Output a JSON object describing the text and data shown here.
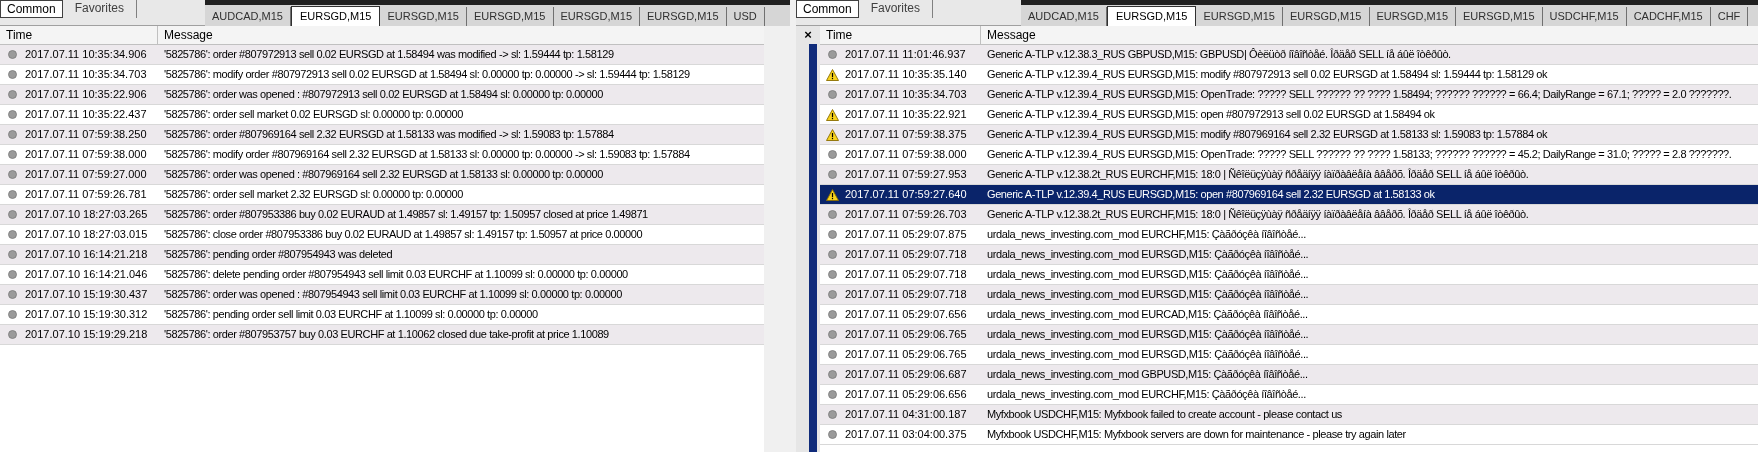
{
  "panels": [
    {
      "terminal_tabs": [
        {
          "label": "Common",
          "selected": true
        },
        {
          "label": "Favorites",
          "selected": false
        }
      ],
      "chart_tabs": [
        {
          "label": "AUDCAD,M15",
          "selected": false
        },
        {
          "label": "EURSGD,M15",
          "selected": true
        },
        {
          "label": "EURSGD,M15",
          "selected": false
        },
        {
          "label": "EURSGD,M15",
          "selected": false
        },
        {
          "label": "EURSGD,M15",
          "selected": false
        },
        {
          "label": "EURSGD,M15",
          "selected": false
        },
        {
          "label": "USD",
          "selected": false
        }
      ],
      "columns": [
        "Time",
        "Message"
      ],
      "rows": [
        {
          "kind": "info",
          "selected": false,
          "time": "2017.07.11 10:35:34.906",
          "message": "'5825786': order #807972913 sell 0.02 EURSGD at 1.58494 was modified -> sl: 1.59444 tp: 1.58129"
        },
        {
          "kind": "info",
          "selected": false,
          "time": "2017.07.11 10:35:34.703",
          "message": "'5825786': modify order #807972913 sell 0.02 EURSGD at 1.58494 sl: 0.00000 tp: 0.00000 -> sl: 1.59444 tp: 1.58129"
        },
        {
          "kind": "info",
          "selected": false,
          "time": "2017.07.11 10:35:22.906",
          "message": "'5825786': order was opened : #807972913 sell 0.02 EURSGD at 1.58494 sl: 0.00000 tp: 0.00000"
        },
        {
          "kind": "info",
          "selected": false,
          "time": "2017.07.11 10:35:22.437",
          "message": "'5825786': order sell market 0.02 EURSGD sl: 0.00000 tp: 0.00000"
        },
        {
          "kind": "info",
          "selected": false,
          "time": "2017.07.11 07:59:38.250",
          "message": "'5825786': order #807969164 sell 2.32 EURSGD at 1.58133 was modified -> sl: 1.59083 tp: 1.57884"
        },
        {
          "kind": "info",
          "selected": false,
          "time": "2017.07.11 07:59:38.000",
          "message": "'5825786': modify order #807969164 sell 2.32 EURSGD at 1.58133 sl: 0.00000 tp: 0.00000 -> sl: 1.59083 tp: 1.57884"
        },
        {
          "kind": "info",
          "selected": false,
          "time": "2017.07.11 07:59:27.000",
          "message": "'5825786': order was opened : #807969164 sell 2.32 EURSGD at 1.58133 sl: 0.00000 tp: 0.00000"
        },
        {
          "kind": "info",
          "selected": false,
          "time": "2017.07.11 07:59:26.781",
          "message": "'5825786': order sell market 2.32 EURSGD sl: 0.00000 tp: 0.00000"
        },
        {
          "kind": "info",
          "selected": false,
          "time": "2017.07.10 18:27:03.265",
          "message": "'5825786': order #807953386 buy 0.02 EURAUD at 1.49857 sl: 1.49157 tp: 1.50957 closed at price 1.49871"
        },
        {
          "kind": "info",
          "selected": false,
          "time": "2017.07.10 18:27:03.015",
          "message": "'5825786': close order #807953386 buy 0.02 EURAUD at 1.49857 sl: 1.49157 tp: 1.50957 at price 0.00000"
        },
        {
          "kind": "info",
          "selected": false,
          "time": "2017.07.10 16:14:21.218",
          "message": "'5825786': pending order #807954943 was deleted"
        },
        {
          "kind": "info",
          "selected": false,
          "time": "2017.07.10 16:14:21.046",
          "message": "'5825786': delete pending order #807954943 sell limit 0.03 EURCHF at 1.10099 sl: 0.00000 tp: 0.00000"
        },
        {
          "kind": "info",
          "selected": false,
          "time": "2017.07.10 15:19:30.437",
          "message": "'5825786': order was opened : #807954943 sell limit 0.03 EURCHF at 1.10099 sl: 0.00000 tp: 0.00000"
        },
        {
          "kind": "info",
          "selected": false,
          "time": "2017.07.10 15:19:30.312",
          "message": "'5825786': pending order sell limit 0.03 EURCHF at 1.10099 sl: 0.00000 tp: 0.00000"
        },
        {
          "kind": "info",
          "selected": false,
          "time": "2017.07.10 15:19:29.218",
          "message": "'5825786': order #807953757 buy 0.03 EURCHF at 1.10062 closed due take-profit at price 1.10089"
        }
      ]
    },
    {
      "close_glyph": "×",
      "terminal_tabs": [
        {
          "label": "Common",
          "selected": true
        },
        {
          "label": "Favorites",
          "selected": false
        }
      ],
      "chart_tabs": [
        {
          "label": "AUDCAD,M15",
          "selected": false
        },
        {
          "label": "EURSGD,M15",
          "selected": true
        },
        {
          "label": "EURSGD,M15",
          "selected": false
        },
        {
          "label": "EURSGD,M15",
          "selected": false
        },
        {
          "label": "EURSGD,M15",
          "selected": false
        },
        {
          "label": "EURSGD,M15",
          "selected": false
        },
        {
          "label": "USDCHF,M15",
          "selected": false
        },
        {
          "label": "CADCHF,M15",
          "selected": false
        },
        {
          "label": "CHF",
          "selected": false
        }
      ],
      "columns": [
        "Time",
        "Message"
      ],
      "rows": [
        {
          "kind": "info",
          "selected": false,
          "time": "2017.07.11 11:01:46.937",
          "message": "Generic A-TLP v.12.38.3_RUS GBPUSD,M15: GBPUSD| Ôèëüòð íîâîñòåé. Îðäåð SELL íå áûë îòêðûò."
        },
        {
          "kind": "warning",
          "selected": false,
          "time": "2017.07.11 10:35:35.140",
          "message": "Generic A-TLP v.12.39.4_RUS EURSGD,M15: modify #807972913 sell 0.02 EURSGD at 1.58494 sl: 1.59444 tp: 1.58129 ok"
        },
        {
          "kind": "info",
          "selected": false,
          "time": "2017.07.11 10:35:34.703",
          "message": "Generic A-TLP v.12.39.4_RUS EURSGD,M15: OpenTrade: ????? SELL ?????? ?? ???? 1.58494; ?????? ?????? = 66.4; DailyRange = 67.1; ????? = 2.0 ???????."
        },
        {
          "kind": "warning",
          "selected": false,
          "time": "2017.07.11 10:35:22.921",
          "message": "Generic A-TLP v.12.39.4_RUS EURSGD,M15: open #807972913 sell 0.02 EURSGD at 1.58494 ok"
        },
        {
          "kind": "warning",
          "selected": false,
          "time": "2017.07.11 07:59:38.375",
          "message": "Generic A-TLP v.12.39.4_RUS EURSGD,M15: modify #807969164 sell 2.32 EURSGD at 1.58133 sl: 1.59083 tp: 1.57884 ok"
        },
        {
          "kind": "info",
          "selected": false,
          "time": "2017.07.11 07:59:38.000",
          "message": "Generic A-TLP v.12.39.4_RUS EURSGD,M15: OpenTrade: ????? SELL ?????? ?? ???? 1.58133; ?????? ?????? = 45.2; DailyRange = 31.0; ????? = 2.8 ???????."
        },
        {
          "kind": "info",
          "selected": false,
          "time": "2017.07.11 07:59:27.953",
          "message": "Generic A-TLP v.12.38.2t_RUS EURCHF,M15: 18:0 | Ñêîëüçÿùàÿ ñðåäíÿÿ íàïðàâëåíà ââåðõ. Îðäåð SELL íå áûë îòêðûò."
        },
        {
          "kind": "warning",
          "selected": true,
          "time": "2017.07.11 07:59:27.640",
          "message": "Generic A-TLP v.12.39.4_RUS EURSGD,M15: open #807969164 sell 2.32 EURSGD at 1.58133 ok"
        },
        {
          "kind": "info",
          "selected": false,
          "time": "2017.07.11 07:59:26.703",
          "message": "Generic A-TLP v.12.38.2t_RUS EURCHF,M15: 18:0 | Ñêîëüçÿùàÿ ñðåäíÿÿ íàïðàâëåíà ââåðõ. Îðäåð SELL íå áûë îòêðûò."
        },
        {
          "kind": "info",
          "selected": false,
          "time": "2017.07.11 05:29:07.875",
          "message": "urdala_news_investing.com_mod EURCHF,M15: Çàãðóçêà íîâîñòåé..."
        },
        {
          "kind": "info",
          "selected": false,
          "time": "2017.07.11 05:29:07.718",
          "message": "urdala_news_investing.com_mod EURSGD,M15: Çàãðóçêà íîâîñòåé..."
        },
        {
          "kind": "info",
          "selected": false,
          "time": "2017.07.11 05:29:07.718",
          "message": "urdala_news_investing.com_mod EURSGD,M15: Çàãðóçêà íîâîñòåé..."
        },
        {
          "kind": "info",
          "selected": false,
          "time": "2017.07.11 05:29:07.718",
          "message": "urdala_news_investing.com_mod EURSGD,M15: Çàãðóçêà íîâîñòåé..."
        },
        {
          "kind": "info",
          "selected": false,
          "time": "2017.07.11 05:29:07.656",
          "message": "urdala_news_investing.com_mod EURCAD,M15: Çàãðóçêà íîâîñòåé..."
        },
        {
          "kind": "info",
          "selected": false,
          "time": "2017.07.11 05:29:06.765",
          "message": "urdala_news_investing.com_mod EURSGD,M15: Çàãðóçêà íîâîñòåé..."
        },
        {
          "kind": "info",
          "selected": false,
          "time": "2017.07.11 05:29:06.765",
          "message": "urdala_news_investing.com_mod EURSGD,M15: Çàãðóçêà íîâîñòåé..."
        },
        {
          "kind": "info",
          "selected": false,
          "time": "2017.07.11 05:29:06.687",
          "message": "urdala_news_investing.com_mod GBPUSD,M15: Çàãðóçêà íîâîñòåé..."
        },
        {
          "kind": "info",
          "selected": false,
          "time": "2017.07.11 05:29:06.656",
          "message": "urdala_news_investing.com_mod EURCHF,M15: Çàãðóçêà íîâîñòåé..."
        },
        {
          "kind": "info",
          "selected": false,
          "time": "2017.07.11 04:31:00.187",
          "message": "Myfxbook USDCHF,M15: Myfxbook failed to create account - please contact us"
        },
        {
          "kind": "info",
          "selected": false,
          "time": "2017.07.11 03:04:00.375",
          "message": "Myfxbook USDCHF,M15: Myfxbook servers are down for maintenance - please try again later"
        }
      ]
    }
  ]
}
